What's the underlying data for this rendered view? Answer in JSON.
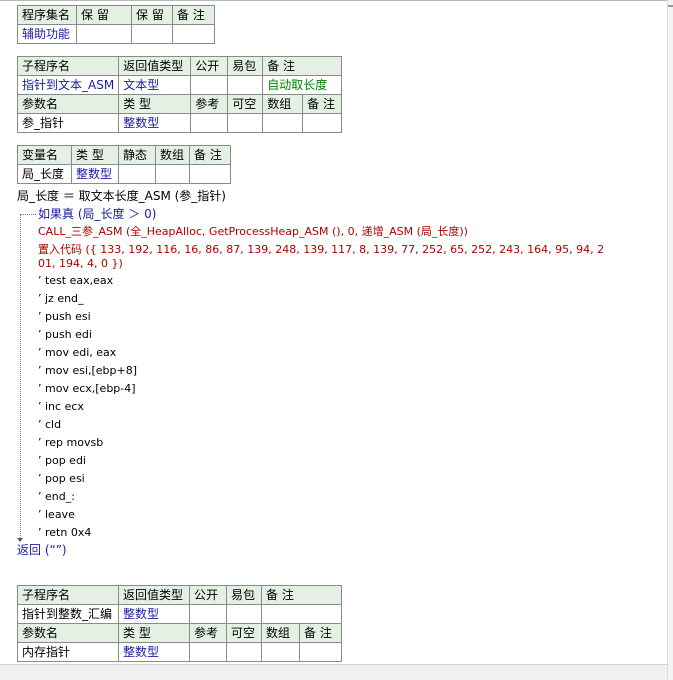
{
  "assembly_table": {
    "headers": [
      "程序集名",
      "保 留",
      "保 留",
      "备 注"
    ],
    "row": [
      "辅助功能",
      "",
      "",
      ""
    ]
  },
  "sub1": {
    "headers": [
      "子程序名",
      "返回值类型",
      "公开",
      "易包",
      "备 注"
    ],
    "row": [
      "指针到文本_ASM",
      "文本型",
      "",
      "",
      "自动取长度"
    ],
    "param_headers": [
      "参数名",
      "类 型",
      "参考",
      "可空",
      "数组",
      "备 注"
    ],
    "param_row": [
      "参_指针",
      "整数型",
      "",
      "",
      "",
      ""
    ]
  },
  "var_table": {
    "headers": [
      "变量名",
      "类 型",
      "静态",
      "数组",
      "备 注"
    ],
    "row": [
      "局_长度",
      "整数型",
      "",
      "",
      ""
    ]
  },
  "code": {
    "line1": "局_长度 ＝ 取文本长度_ASM (参_指针)",
    "if_line": "如果真 (局_长度 ＞ 0)",
    "call_line": "CALL_三参_ASM (全_HeapAlloc, GetProcessHeap_ASM (), 0, 递增_ASM (局_长度))",
    "putcode_line1": "置入代码 ({ 133, 192, 116, 16, 86, 87, 139, 248, 139, 117, 8, 139, 77, 252, 65, 252, 243, 164, 95, 94, 2",
    "putcode_line2": "01, 194, 4, 0 })",
    "comments": [
      "’ test eax,eax",
      "’ jz end_",
      "’ push esi",
      "’ push edi",
      "’ mov edi, eax",
      "’ mov esi,[ebp+8]",
      "’ mov ecx,[ebp-4]",
      "’ inc ecx",
      "’ cld",
      "’ rep movsb",
      "’ pop edi",
      "’ pop esi",
      "’ end_:",
      "’ leave",
      "’ retn 0x4"
    ],
    "return_line": "返回 (“”)"
  },
  "sub2": {
    "headers": [
      "子程序名",
      "返回值类型",
      "公开",
      "易包",
      "备 注"
    ],
    "row": [
      "指针到整数_汇编",
      "整数型",
      "",
      "",
      ""
    ],
    "param_headers": [
      "参数名",
      "类 型",
      "参考",
      "可空",
      "数组",
      "备 注"
    ],
    "param_row": [
      "内存指针",
      "整数型",
      "",
      "",
      "",
      ""
    ]
  }
}
